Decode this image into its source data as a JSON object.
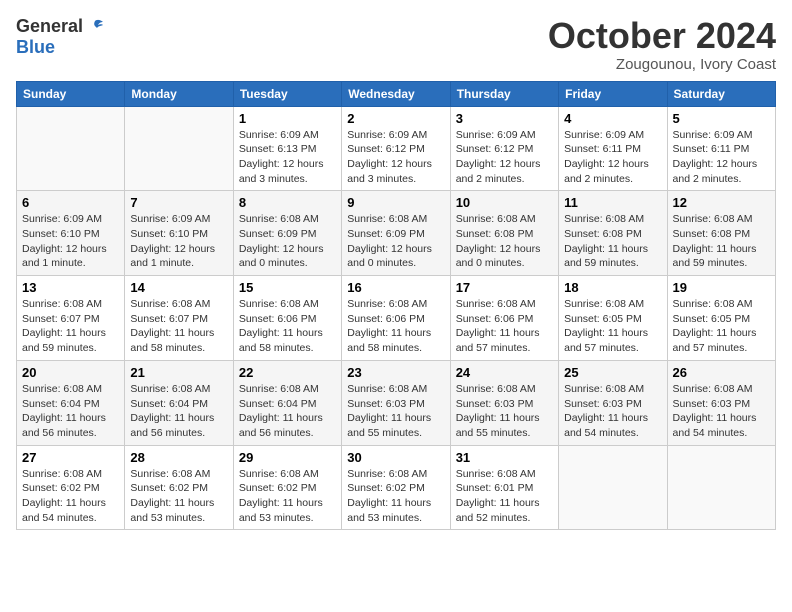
{
  "header": {
    "logo_general": "General",
    "logo_blue": "Blue",
    "month": "October 2024",
    "location": "Zougounou, Ivory Coast"
  },
  "weekdays": [
    "Sunday",
    "Monday",
    "Tuesday",
    "Wednesday",
    "Thursday",
    "Friday",
    "Saturday"
  ],
  "weeks": [
    [
      {
        "day": "",
        "detail": ""
      },
      {
        "day": "",
        "detail": ""
      },
      {
        "day": "1",
        "detail": "Sunrise: 6:09 AM\nSunset: 6:13 PM\nDaylight: 12 hours and 3 minutes."
      },
      {
        "day": "2",
        "detail": "Sunrise: 6:09 AM\nSunset: 6:12 PM\nDaylight: 12 hours and 3 minutes."
      },
      {
        "day": "3",
        "detail": "Sunrise: 6:09 AM\nSunset: 6:12 PM\nDaylight: 12 hours and 2 minutes."
      },
      {
        "day": "4",
        "detail": "Sunrise: 6:09 AM\nSunset: 6:11 PM\nDaylight: 12 hours and 2 minutes."
      },
      {
        "day": "5",
        "detail": "Sunrise: 6:09 AM\nSunset: 6:11 PM\nDaylight: 12 hours and 2 minutes."
      }
    ],
    [
      {
        "day": "6",
        "detail": "Sunrise: 6:09 AM\nSunset: 6:10 PM\nDaylight: 12 hours and 1 minute."
      },
      {
        "day": "7",
        "detail": "Sunrise: 6:09 AM\nSunset: 6:10 PM\nDaylight: 12 hours and 1 minute."
      },
      {
        "day": "8",
        "detail": "Sunrise: 6:08 AM\nSunset: 6:09 PM\nDaylight: 12 hours and 0 minutes."
      },
      {
        "day": "9",
        "detail": "Sunrise: 6:08 AM\nSunset: 6:09 PM\nDaylight: 12 hours and 0 minutes."
      },
      {
        "day": "10",
        "detail": "Sunrise: 6:08 AM\nSunset: 6:08 PM\nDaylight: 12 hours and 0 minutes."
      },
      {
        "day": "11",
        "detail": "Sunrise: 6:08 AM\nSunset: 6:08 PM\nDaylight: 11 hours and 59 minutes."
      },
      {
        "day": "12",
        "detail": "Sunrise: 6:08 AM\nSunset: 6:08 PM\nDaylight: 11 hours and 59 minutes."
      }
    ],
    [
      {
        "day": "13",
        "detail": "Sunrise: 6:08 AM\nSunset: 6:07 PM\nDaylight: 11 hours and 59 minutes."
      },
      {
        "day": "14",
        "detail": "Sunrise: 6:08 AM\nSunset: 6:07 PM\nDaylight: 11 hours and 58 minutes."
      },
      {
        "day": "15",
        "detail": "Sunrise: 6:08 AM\nSunset: 6:06 PM\nDaylight: 11 hours and 58 minutes."
      },
      {
        "day": "16",
        "detail": "Sunrise: 6:08 AM\nSunset: 6:06 PM\nDaylight: 11 hours and 58 minutes."
      },
      {
        "day": "17",
        "detail": "Sunrise: 6:08 AM\nSunset: 6:06 PM\nDaylight: 11 hours and 57 minutes."
      },
      {
        "day": "18",
        "detail": "Sunrise: 6:08 AM\nSunset: 6:05 PM\nDaylight: 11 hours and 57 minutes."
      },
      {
        "day": "19",
        "detail": "Sunrise: 6:08 AM\nSunset: 6:05 PM\nDaylight: 11 hours and 57 minutes."
      }
    ],
    [
      {
        "day": "20",
        "detail": "Sunrise: 6:08 AM\nSunset: 6:04 PM\nDaylight: 11 hours and 56 minutes."
      },
      {
        "day": "21",
        "detail": "Sunrise: 6:08 AM\nSunset: 6:04 PM\nDaylight: 11 hours and 56 minutes."
      },
      {
        "day": "22",
        "detail": "Sunrise: 6:08 AM\nSunset: 6:04 PM\nDaylight: 11 hours and 56 minutes."
      },
      {
        "day": "23",
        "detail": "Sunrise: 6:08 AM\nSunset: 6:03 PM\nDaylight: 11 hours and 55 minutes."
      },
      {
        "day": "24",
        "detail": "Sunrise: 6:08 AM\nSunset: 6:03 PM\nDaylight: 11 hours and 55 minutes."
      },
      {
        "day": "25",
        "detail": "Sunrise: 6:08 AM\nSunset: 6:03 PM\nDaylight: 11 hours and 54 minutes."
      },
      {
        "day": "26",
        "detail": "Sunrise: 6:08 AM\nSunset: 6:03 PM\nDaylight: 11 hours and 54 minutes."
      }
    ],
    [
      {
        "day": "27",
        "detail": "Sunrise: 6:08 AM\nSunset: 6:02 PM\nDaylight: 11 hours and 54 minutes."
      },
      {
        "day": "28",
        "detail": "Sunrise: 6:08 AM\nSunset: 6:02 PM\nDaylight: 11 hours and 53 minutes."
      },
      {
        "day": "29",
        "detail": "Sunrise: 6:08 AM\nSunset: 6:02 PM\nDaylight: 11 hours and 53 minutes."
      },
      {
        "day": "30",
        "detail": "Sunrise: 6:08 AM\nSunset: 6:02 PM\nDaylight: 11 hours and 53 minutes."
      },
      {
        "day": "31",
        "detail": "Sunrise: 6:08 AM\nSunset: 6:01 PM\nDaylight: 11 hours and 52 minutes."
      },
      {
        "day": "",
        "detail": ""
      },
      {
        "day": "",
        "detail": ""
      }
    ]
  ]
}
